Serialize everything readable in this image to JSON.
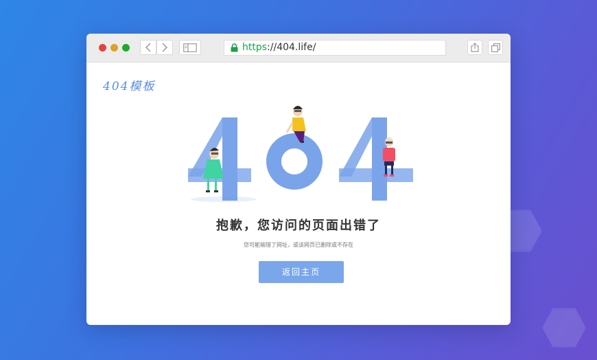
{
  "browser": {
    "url_scheme": "https",
    "url_rest": "://404.life/"
  },
  "page": {
    "logo_text": "404模板",
    "headline": "抱歉，您访问的页面出错了",
    "subtext": "您可能输错了网址，或该网页已删除或不存在",
    "home_button": "返回主页",
    "error_code_art": "404"
  },
  "icons": {
    "back": "chevron-left-icon",
    "forward": "chevron-right-icon",
    "sidebar": "sidebar-icon",
    "lock": "lock-icon",
    "share": "share-icon",
    "tabs": "tabs-icon"
  },
  "colors": {
    "traffic_red": "#e0443e",
    "traffic_yellow": "#dea123",
    "traffic_green": "#1aab29",
    "accent_blue": "#7aa7ec",
    "digit_blue": "#6c9ae8"
  }
}
